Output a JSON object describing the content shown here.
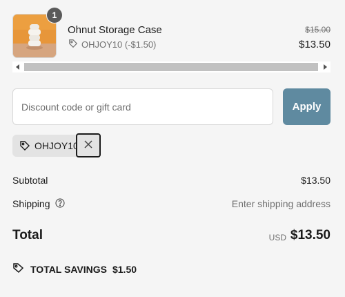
{
  "cart": {
    "item": {
      "quantity": "1",
      "name": "Ohnut Storage Case",
      "discount_text": "OHJOY10 (-$1.50)",
      "original_price": "$15.00",
      "final_price": "$13.50"
    }
  },
  "discount": {
    "placeholder": "Discount code or gift card",
    "value": "",
    "apply_label": "Apply",
    "applied_code": "OHJOY10"
  },
  "summary": {
    "subtotal_label": "Subtotal",
    "subtotal_value": "$13.50",
    "shipping_label": "Shipping",
    "shipping_value": "Enter shipping address",
    "total_label": "Total",
    "total_currency": "USD",
    "total_value": "$13.50",
    "savings_label": "TOTAL SAVINGS",
    "savings_value": "$1.50"
  },
  "colors": {
    "accent": "#5f8aa0",
    "background": "#f5f5f5",
    "chip": "#e3e3e3"
  },
  "icons": [
    "product-thumbnail",
    "tag-icon",
    "close-icon",
    "help-circle-icon",
    "savings-tag-icon",
    "scroll-left-icon",
    "scroll-right-icon"
  ]
}
